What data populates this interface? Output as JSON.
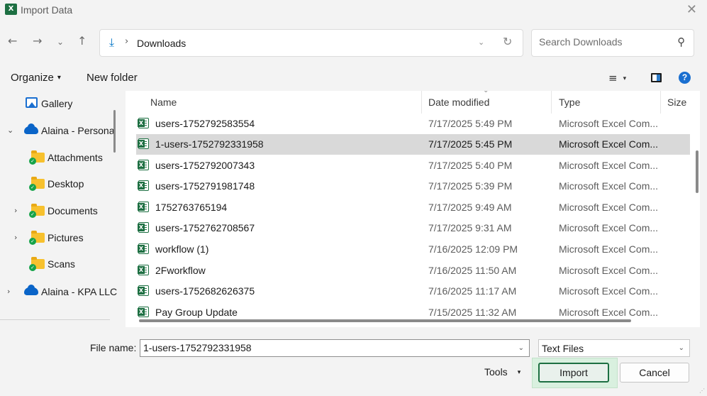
{
  "window": {
    "title": "Import Data",
    "app_icon": "excel-icon",
    "close_glyph": "✕"
  },
  "nav_buttons": {
    "back": "←",
    "forward": "→",
    "recent": "⌄",
    "up": "↑"
  },
  "address": {
    "icon": "download-icon",
    "separator": "›",
    "location": "Downloads",
    "dropdown": "⌄",
    "refresh": "↻"
  },
  "search": {
    "placeholder": "Search Downloads",
    "icon": "⚲"
  },
  "commands": {
    "organize": "Organize",
    "new_folder": "New folder",
    "view_icon": "≡",
    "caret": "▾",
    "help": "?"
  },
  "navpane": {
    "items": [
      {
        "label": "Gallery",
        "icon": "gallery-icon",
        "chevron": ""
      },
      {
        "label": "Alaina - Persona",
        "icon": "onedrive-icon",
        "chevron": "⌄"
      },
      {
        "label": "Attachments",
        "icon": "folder-icon",
        "chevron": ""
      },
      {
        "label": "Desktop",
        "icon": "folder-icon",
        "chevron": ""
      },
      {
        "label": "Documents",
        "icon": "folder-icon",
        "chevron": "›"
      },
      {
        "label": "Pictures",
        "icon": "folder-icon",
        "chevron": "›"
      },
      {
        "label": "Scans",
        "icon": "folder-icon",
        "chevron": ""
      },
      {
        "label": "Alaina - KPA LLC",
        "icon": "onedrive-icon",
        "chevron": "›"
      }
    ]
  },
  "filelist": {
    "columns": {
      "name": "Name",
      "date": "Date modified",
      "type": "Type",
      "size": "Size"
    },
    "sort_indicator": "⌄",
    "rows": [
      {
        "name": "users-1752792583554",
        "date": "7/17/2025 5:49 PM",
        "type": "Microsoft Excel Com...",
        "selected": false
      },
      {
        "name": "1-users-1752792331958",
        "date": "7/17/2025 5:45 PM",
        "type": "Microsoft Excel Com...",
        "selected": true
      },
      {
        "name": "users-1752792007343",
        "date": "7/17/2025 5:40 PM",
        "type": "Microsoft Excel Com...",
        "selected": false
      },
      {
        "name": "users-1752791981748",
        "date": "7/17/2025 5:39 PM",
        "type": "Microsoft Excel Com...",
        "selected": false
      },
      {
        "name": "1752763765194",
        "date": "7/17/2025 9:49 AM",
        "type": "Microsoft Excel Com...",
        "selected": false
      },
      {
        "name": "users-1752762708567",
        "date": "7/17/2025 9:31 AM",
        "type": "Microsoft Excel Com...",
        "selected": false
      },
      {
        "name": "workflow (1)",
        "date": "7/16/2025 12:09 PM",
        "type": "Microsoft Excel Com...",
        "selected": false
      },
      {
        "name": "2Fworkflow",
        "date": "7/16/2025 11:50 AM",
        "type": "Microsoft Excel Com...",
        "selected": false
      },
      {
        "name": "users-1752682626375",
        "date": "7/16/2025 11:17 AM",
        "type": "Microsoft Excel Com...",
        "selected": false
      },
      {
        "name": "Pay Group Update",
        "date": "7/15/2025 11:32 AM",
        "type": "Microsoft Excel Com...",
        "selected": false
      }
    ]
  },
  "footer": {
    "file_name_label": "File name:",
    "file_name_value": "1-users-1752792331958",
    "file_type_value": "Text Files",
    "dropdown": "⌄",
    "tools_label": "Tools",
    "tools_caret": "▾",
    "import_label": "Import",
    "cancel_label": "Cancel",
    "grip": "⋰"
  },
  "colors": {
    "excel_green": "#1d6f42",
    "accent_blue": "#1a6fd0",
    "selection": "#d9d9d9",
    "folder": "#f7c12e"
  }
}
